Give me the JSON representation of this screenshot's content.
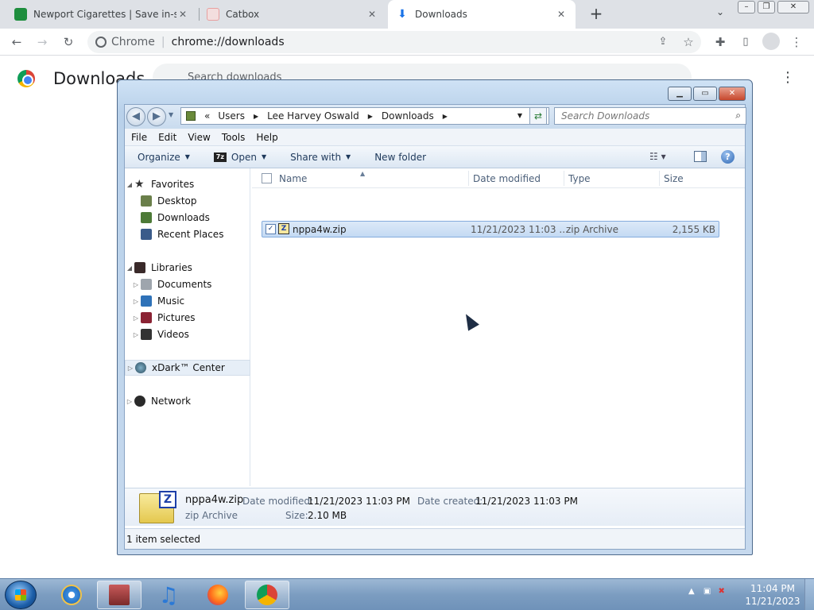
{
  "browser": {
    "tabs": [
      {
        "title": "Newport Cigarettes | Save in-sto",
        "favicon_color": "#1e8e3e"
      },
      {
        "title": "Catbox",
        "favicon_color": "#e8a0a0"
      },
      {
        "title": "Downloads",
        "favicon_color": "#1a73e8"
      }
    ],
    "omnibox_site": "Chrome",
    "omnibox_url": "chrome://downloads"
  },
  "downloads_page": {
    "title": "Downloads",
    "search_placeholder": "Search downloads"
  },
  "explorer": {
    "breadcrumb": [
      "«",
      "Users",
      "Lee Harvey Oswald",
      "Downloads"
    ],
    "search_placeholder": "Search Downloads",
    "menu": [
      "File",
      "Edit",
      "View",
      "Tools",
      "Help"
    ],
    "commands": {
      "organize": "Organize",
      "open": "Open",
      "open_badge": "7z",
      "share": "Share with",
      "new_folder": "New folder"
    },
    "nav": {
      "favorites": {
        "label": "Favorites",
        "items": [
          "Desktop",
          "Downloads",
          "Recent Places"
        ]
      },
      "libraries": {
        "label": "Libraries",
        "items": [
          "Documents",
          "Music",
          "Pictures",
          "Videos"
        ]
      },
      "xdark": "xDark™ Center",
      "network": "Network"
    },
    "columns": [
      "Name",
      "Date modified",
      "Type",
      "Size"
    ],
    "files": [
      {
        "name": "nppa4w.zip",
        "date_modified": "11/21/2023 11:03 ...",
        "type": "zip Archive",
        "size": "2,155 KB",
        "selected": true
      }
    ],
    "details": {
      "name": "nppa4w.zip",
      "type": "zip Archive",
      "date_modified_label": "Date modified:",
      "date_modified": "11/21/2023 11:03 PM",
      "date_created_label": "Date created:",
      "date_created": "11/21/2023 11:03 PM",
      "size_label": "Size:",
      "size": "2.10 MB"
    },
    "status": "1 item selected"
  },
  "taskbar": {
    "time": "11:04 PM",
    "date": "11/21/2023"
  },
  "colors": {
    "selection": "#c4daf3",
    "chrome_blue": "#1a73e8"
  }
}
